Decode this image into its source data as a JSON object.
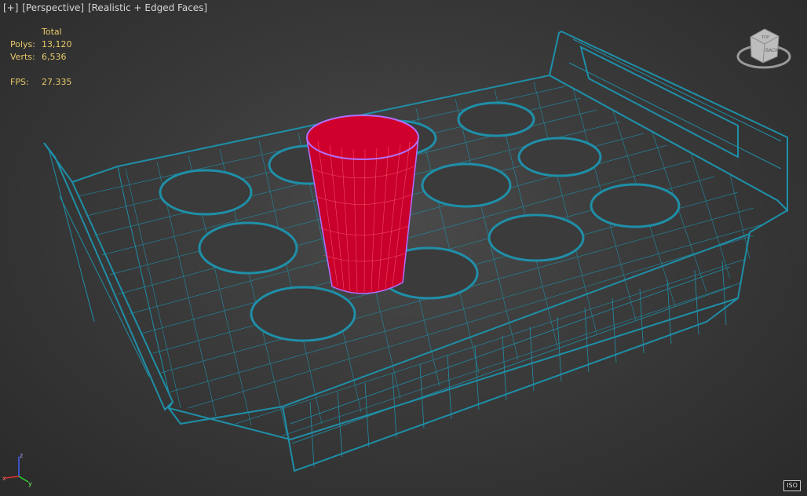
{
  "viewport_label": {
    "plus": "[+]",
    "view": "[Perspective]",
    "shading": "[Realistic + Edged Faces]"
  },
  "stats": {
    "header": "Total",
    "polys_label": "Polys:",
    "polys_value": "13,120",
    "verts_label": "Verts:",
    "verts_value": "6,536",
    "fps_label": "FPS:",
    "fps_value": "27.335"
  },
  "viewcube": {
    "face_top": "TOP",
    "face_front": "BACK"
  },
  "axis": {
    "z": "z",
    "x": "x",
    "y": "y"
  },
  "iso_badge": "ISO",
  "colors": {
    "wireframe": "#1f8fa8",
    "cup_fill": "#c8002a",
    "cup_edge": "#b070ff",
    "stats_text": "#e8c96a",
    "axis_x": "#e03030",
    "axis_y": "#30d030",
    "axis_z": "#4060ff"
  }
}
